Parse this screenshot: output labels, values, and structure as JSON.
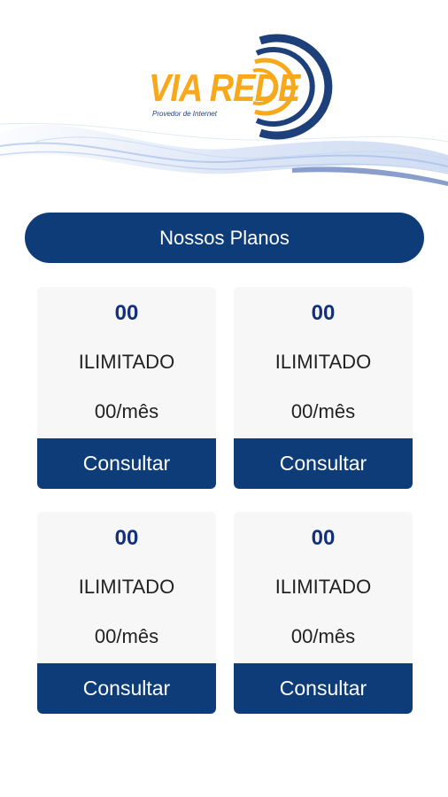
{
  "header": {
    "logo_text": "VIA REDE",
    "logo_subtitle": "Provedor de Internet",
    "colors": {
      "logo_orange": "#f7a81b",
      "logo_navy": "#1d3f7a"
    }
  },
  "title": "Nossos Planos",
  "plans": [
    {
      "speed": "00",
      "name": "ILIMITADO",
      "price": "00/mês",
      "button": "Consultar"
    },
    {
      "speed": "00",
      "name": "ILIMITADO",
      "price": "00/mês",
      "button": "Consultar"
    },
    {
      "speed": "00",
      "name": "ILIMITADO",
      "price": "00/mês",
      "button": "Consultar"
    },
    {
      "speed": "00",
      "name": "ILIMITADO",
      "price": "00/mês",
      "button": "Consultar"
    }
  ],
  "colors": {
    "primary": "#0d3c78",
    "card_bg": "#f7f7f7",
    "speed_text": "#14307a"
  }
}
